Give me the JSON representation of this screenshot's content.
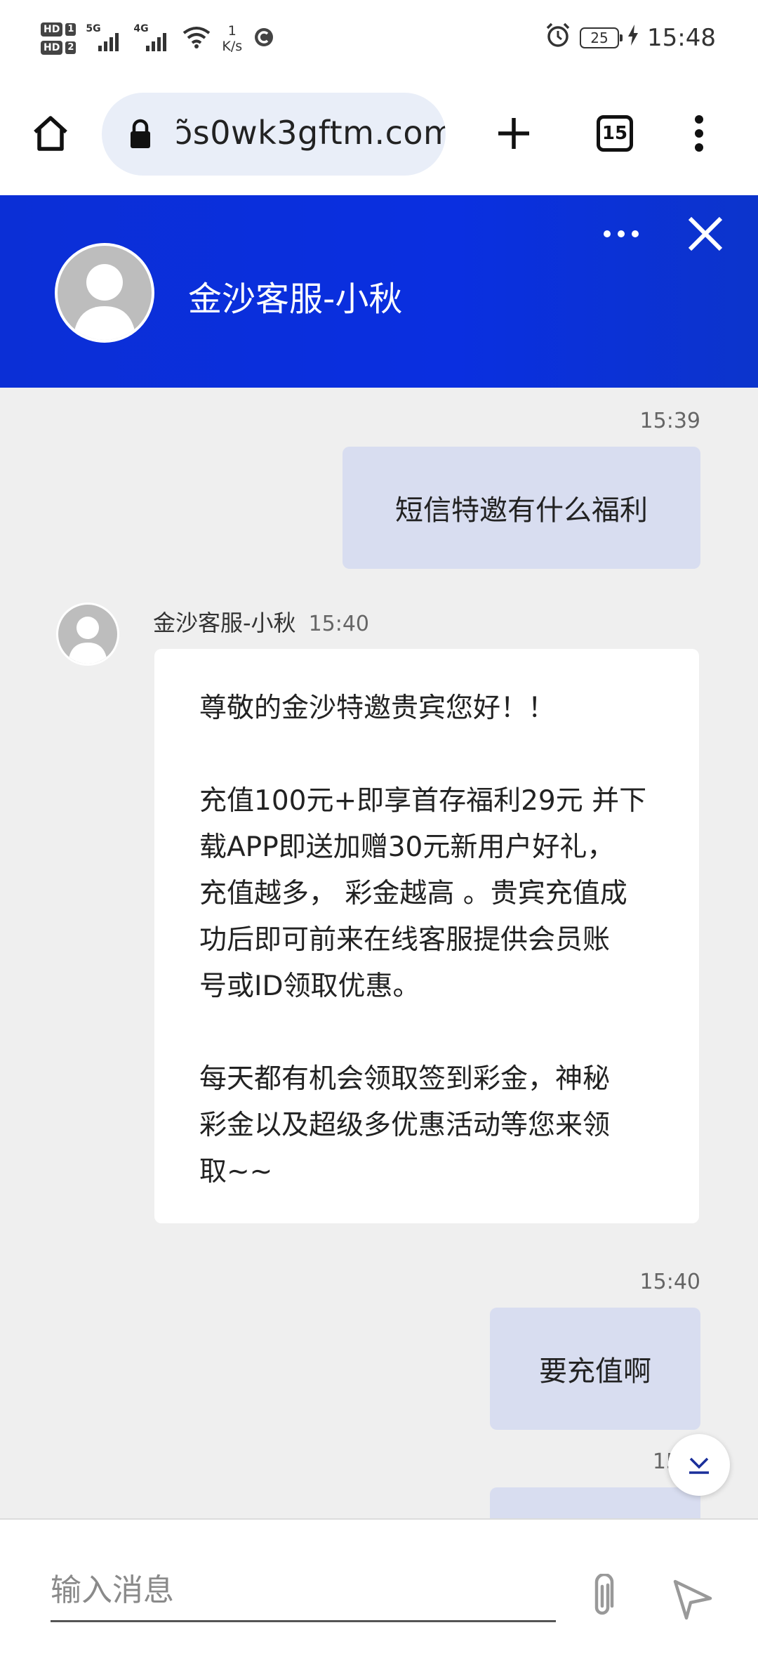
{
  "status_bar": {
    "hd1": "HD",
    "hd1_num": "1",
    "hd2": "HD",
    "hd2_num": "2",
    "signal1": "5G",
    "signal2": "4G",
    "net_speed_value": "1",
    "net_speed_unit": "K/s",
    "battery": "25",
    "time": "15:48"
  },
  "browser": {
    "url": "ɔ̃s0wk3gftm.com",
    "tab_count": "15"
  },
  "chat": {
    "agent_name": "金沙客服-小秋",
    "messages": [
      {
        "type": "user",
        "time": "15:39",
        "text": "短信特邀有什么福利"
      },
      {
        "type": "agent",
        "time": "15:40",
        "name": "金沙客服-小秋",
        "paragraphs": [
          "尊敬的金沙特邀贵宾您好！！",
          "充值100元+即享首存福利29元 并下\n载APP即送加赠30元新用户好礼，\n充值越多， 彩金越高 。贵宾充值成\n功后即可前来在线客服提供会员账\n号或ID领取优惠。",
          "每天都有机会领取签到彩金，神秘\n彩金以及超级多优惠活动等您来领\n取~~"
        ]
      },
      {
        "type": "user",
        "time": "15:40",
        "text": "要充值啊"
      },
      {
        "type": "user",
        "time": "15",
        "text": ""
      }
    ]
  },
  "composer": {
    "placeholder": "输入消息"
  },
  "icons": {
    "home": "home-icon",
    "lock": "lock-icon",
    "new_tab": "plus-icon",
    "menu": "more-vert-icon",
    "chat_more": "more-horiz-icon",
    "close": "close-icon",
    "scroll_down": "chevron-down-icon",
    "attach": "paperclip-icon",
    "send": "send-icon"
  },
  "colors": {
    "header_blue": "#0b2fd6",
    "user_bubble": "#d8ddf0",
    "agent_bubble": "#ffffff",
    "background": "#efefef"
  }
}
